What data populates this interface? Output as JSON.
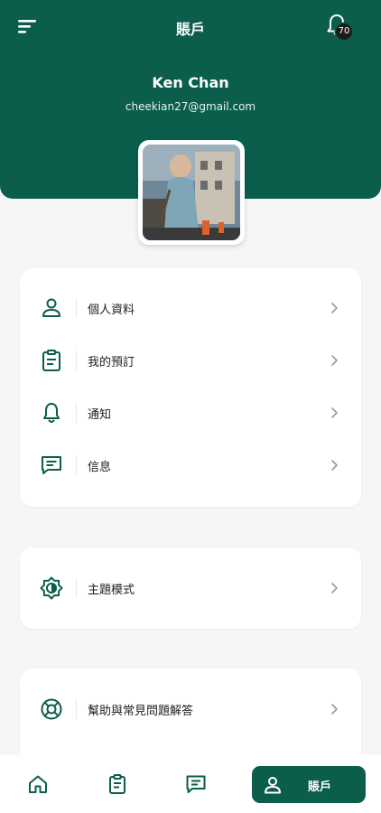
{
  "header": {
    "title": "賬戶",
    "notification_count": "70",
    "icons": [
      "menu-icon",
      "bell-icon"
    ],
    "background": "#0b5e4b"
  },
  "user": {
    "name": "Ken Chan",
    "email": "cheekian27@gmail.com"
  },
  "menu_groups": [
    {
      "items": [
        {
          "label": "個人資料",
          "icon": "user-icon"
        },
        {
          "label": "我的預訂",
          "icon": "clipboard-icon"
        },
        {
          "label": "通知",
          "icon": "bell-icon"
        },
        {
          "label": "信息",
          "icon": "message-icon"
        }
      ]
    },
    {
      "items": [
        {
          "label": "主題模式",
          "icon": "theme-icon"
        }
      ]
    },
    {
      "items": [
        {
          "label": "幫助與常見問題解答",
          "icon": "help-lifebuoy-icon"
        }
      ]
    }
  ],
  "bottom_nav": {
    "items": [
      {
        "icon": "home-icon"
      },
      {
        "icon": "clipboard-icon"
      },
      {
        "icon": "message-icon"
      },
      {
        "icon": "user-icon",
        "label": "賬戶",
        "active": true
      }
    ]
  },
  "colors": {
    "accent": "#0b5e4b",
    "background": "#f6f6f6"
  }
}
